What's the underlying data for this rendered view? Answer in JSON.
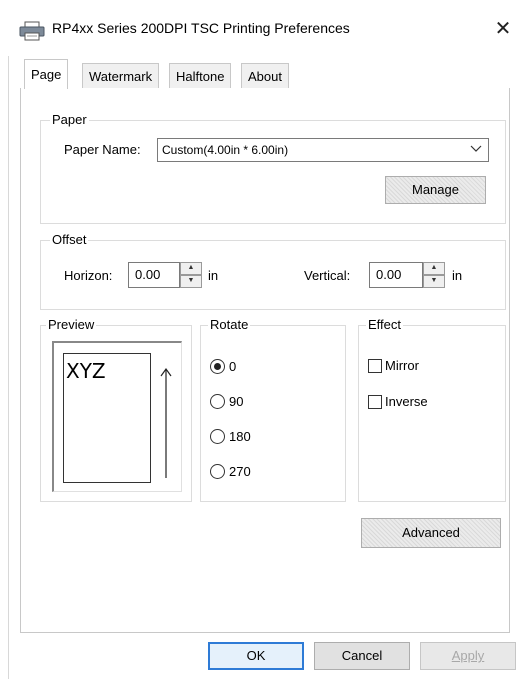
{
  "window": {
    "title": "RP4xx Series 200DPI TSC Printing Preferences",
    "close_glyph": "✕"
  },
  "tabs": [
    {
      "label": "Page",
      "active": true
    },
    {
      "label": "Watermark",
      "active": false
    },
    {
      "label": "Halftone",
      "active": false
    },
    {
      "label": "About",
      "active": false
    }
  ],
  "paper": {
    "group_label": "Paper",
    "name_label": "Paper Name:",
    "selected": "Custom(4.00in * 6.00in)",
    "manage_button": "Manage"
  },
  "offset": {
    "group_label": "Offset",
    "horizon_label": "Horizon:",
    "horizon_value": "0.00",
    "horizon_unit": "in",
    "vertical_label": "Vertical:",
    "vertical_value": "0.00",
    "vertical_unit": "in"
  },
  "preview": {
    "group_label": "Preview",
    "sample_text": "XYZ",
    "arrow_glyph": "↑"
  },
  "rotate": {
    "group_label": "Rotate",
    "options": [
      {
        "label": "0",
        "checked": true
      },
      {
        "label": "90",
        "checked": false
      },
      {
        "label": "180",
        "checked": false
      },
      {
        "label": "270",
        "checked": false
      }
    ]
  },
  "effect": {
    "group_label": "Effect",
    "options": [
      {
        "label": "Mirror",
        "checked": false
      },
      {
        "label": "Inverse",
        "checked": false
      }
    ]
  },
  "advanced_button": "Advanced",
  "footer": {
    "ok": "OK",
    "cancel": "Cancel",
    "apply": "Apply"
  },
  "icons": {
    "printer": "printer-icon",
    "dropdown": "chevron-down-icon",
    "spin_up": "spin-up-icon",
    "spin_down": "spin-down-icon"
  },
  "colors": {
    "default_button_border": "#2e7bd6",
    "group_border": "#dcdcdc"
  }
}
